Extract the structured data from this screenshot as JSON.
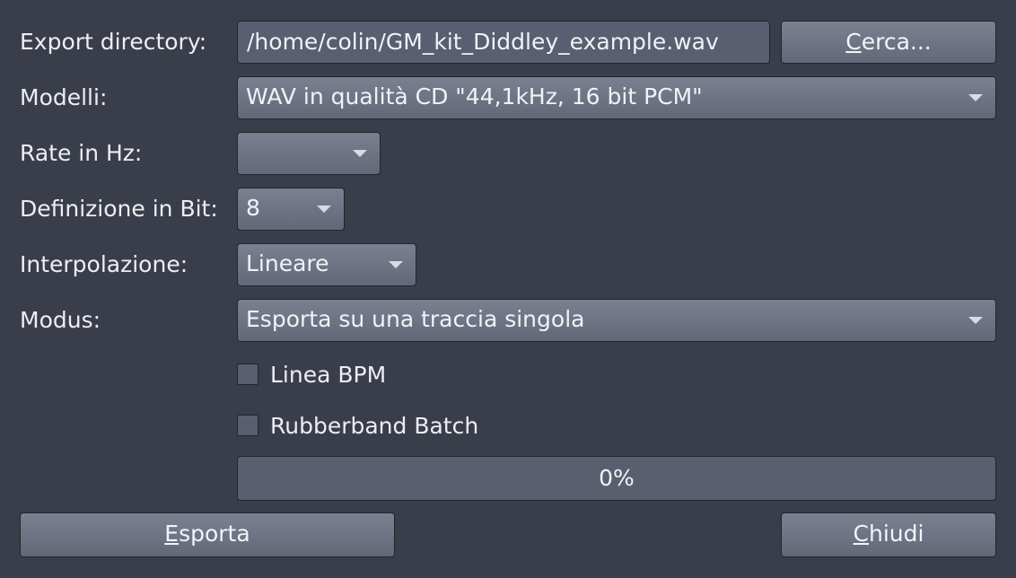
{
  "export_directory": {
    "label": "Export directory:",
    "value": "/home/colin/GM_kit_Diddley_example.wav",
    "browse_button": {
      "mnemonic": "C",
      "rest": "erca..."
    }
  },
  "templates": {
    "label": "Modelli:",
    "selected": "WAV in qualità CD  \"44,1kHz, 16 bit PCM\""
  },
  "sample_rate": {
    "label": "Rate in Hz:",
    "selected": ""
  },
  "bit_depth": {
    "label": "Definizione in Bit:",
    "selected": "8"
  },
  "interpolation": {
    "label": "Interpolazione:",
    "selected": "Lineare"
  },
  "mode": {
    "label": "Modus:",
    "selected": "Esporta su una traccia singola"
  },
  "options": {
    "bpm_line": {
      "label": "Linea BPM",
      "checked": false
    },
    "rubberband_batch": {
      "label": "Rubberband Batch",
      "checked": false
    }
  },
  "progress": {
    "value": 0,
    "text": "0%"
  },
  "buttons": {
    "export": {
      "mnemonic": "E",
      "rest": "sporta"
    },
    "close": {
      "mnemonic": "C",
      "rest": "hiudi"
    }
  }
}
